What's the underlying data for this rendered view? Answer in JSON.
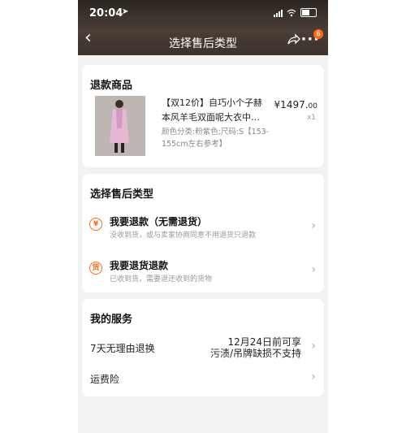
{
  "status_bar": {
    "time": "20:04"
  },
  "header": {
    "title": "选择售后类型",
    "badge": "6"
  },
  "refund_goods": {
    "section_title": "退款商品",
    "product": {
      "name": "【双12价】自巧小个子赫本风羊毛双面呢大衣中…",
      "sku": "颜色分类:粉紫色;尺码:S【153-155cm左右参考】",
      "price_main": "¥1497.",
      "price_decimal": "00",
      "quantity": "x1"
    }
  },
  "aftersale_types": {
    "section_title": "选择售后类型",
    "options": [
      {
        "icon": "¥",
        "title": "我要退款（无需退货）",
        "subtitle": "没收到货，或与卖家协商同意不用退货只退款"
      },
      {
        "icon": "货",
        "title": "我要退货退款",
        "subtitle": "已收到货，需要退还收到的货物"
      }
    ]
  },
  "my_services": {
    "section_title": "我的服务",
    "rows": [
      {
        "label": "7天无理由退换",
        "right_line1": "12月24日前可享",
        "right_line2": "污渍/吊牌缺损不支持"
      },
      {
        "label": "运费险"
      }
    ]
  },
  "colors": {
    "accent": "#ff6a1a",
    "page_bg": "#f2f2f2"
  },
  "icons": [
    "back-icon",
    "share-icon",
    "more-icon",
    "yen-icon",
    "return-goods-icon",
    "chevron-right-icon"
  ]
}
